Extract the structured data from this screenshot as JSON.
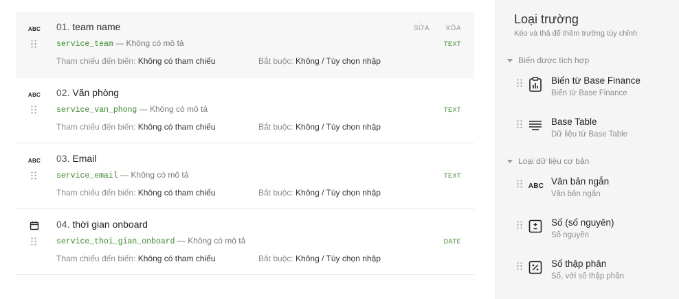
{
  "fields": [
    {
      "index": "01.",
      "name": "team name",
      "icon": "abc-icon",
      "icon_text": "ABC",
      "key": "service_team",
      "separator": " — ",
      "description": "Không có mô tả",
      "ref_label": "Tham chiếu đến biến:",
      "ref_value": "Không có tham chiếu",
      "req_label": "Bắt buộc:",
      "req_value": "Không / Tùy chọn nhập",
      "type": "TEXT",
      "edit_label": "SỬA",
      "delete_label": "XÓA"
    },
    {
      "index": "02.",
      "name": "Văn phòng",
      "icon": "abc-icon",
      "icon_text": "ABC",
      "key": "service_van_phong",
      "separator": " — ",
      "description": "Không có mô tả",
      "ref_label": "Tham chiếu đến biến:",
      "ref_value": "Không có tham chiếu",
      "req_label": "Bắt buộc:",
      "req_value": "Không / Tùy chọn nhập",
      "type": "TEXT"
    },
    {
      "index": "03.",
      "name": "Email",
      "icon": "abc-icon",
      "icon_text": "ABC",
      "key": "service_email",
      "separator": " — ",
      "description": "Không có mô tả",
      "ref_label": "Tham chiếu đến biến:",
      "ref_value": "Không có tham chiếu",
      "req_label": "Bắt buộc:",
      "req_value": "Không / Tùy chọn nhập",
      "type": "TEXT"
    },
    {
      "index": "04.",
      "name": "thời gian onboard",
      "icon": "calendar-icon",
      "key": "service_thoi_gian_onboard",
      "separator": " — ",
      "description": "Không có mô tả",
      "ref_label": "Tham chiếu đến biến:",
      "ref_value": "Không có tham chiếu",
      "req_label": "Bắt buộc:",
      "req_value": "Không / Tùy chọn nhập",
      "type": "DATE"
    }
  ],
  "panel": {
    "title": "Loại trường",
    "subtitle": "Kéo và thả để thêm trường tùy chỉnh",
    "sections": [
      {
        "label": "Biến được tích hợp",
        "items": [
          {
            "title": "Biến từ Base Finance",
            "desc": "Biến từ Base Finance",
            "icon": "clipboard-chart-icon"
          },
          {
            "title": "Base Table",
            "desc": "Dữ liệu từ Base Table",
            "icon": "table-lines-icon"
          }
        ]
      },
      {
        "label": "Loại dữ liệu cơ bản",
        "items": [
          {
            "title": "Văn bản ngắn",
            "desc": "Văn bản ngắn",
            "icon": "abc-icon",
            "icon_text": "ABC"
          },
          {
            "title": "Số (số nguyên)",
            "desc": "Số nguyên",
            "icon": "plus-minus-box-icon"
          },
          {
            "title": "Số thập phân",
            "desc": "Số, với số thập phân",
            "icon": "percent-box-icon"
          }
        ]
      }
    ]
  },
  "colors": {
    "code_green": "#3a8c2c",
    "panel_bg": "#f5f5f5",
    "active_row_bg": "#f7f7f7"
  }
}
